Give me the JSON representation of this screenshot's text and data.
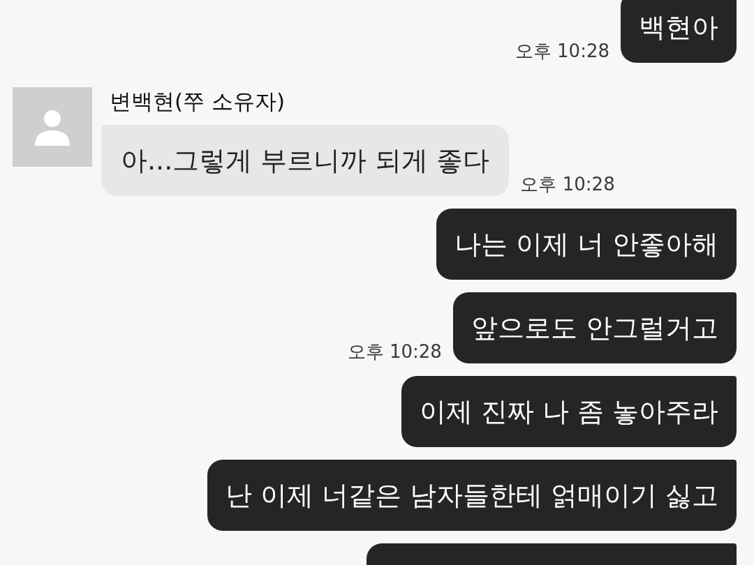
{
  "messages": [
    {
      "kind": "sent",
      "text": "백현아",
      "time": "오후 10:28"
    },
    {
      "kind": "received",
      "sender": "변백현(쭈 소유자)",
      "text": "아...그렇게 부르니까 되게 좋다",
      "time": "오후 10:28"
    },
    {
      "kind": "sent",
      "text": "나는 이제 너 안좋아해"
    },
    {
      "kind": "sent",
      "text": "앞으로도 안그럴거고",
      "time": "오후 10:28"
    },
    {
      "kind": "sent",
      "text": "이제 진짜 나 좀 놓아주라"
    },
    {
      "kind": "sent",
      "text": "난 이제 너같은 남자들한테 얽매이기 싫고"
    },
    {
      "kind": "sent"
    }
  ]
}
